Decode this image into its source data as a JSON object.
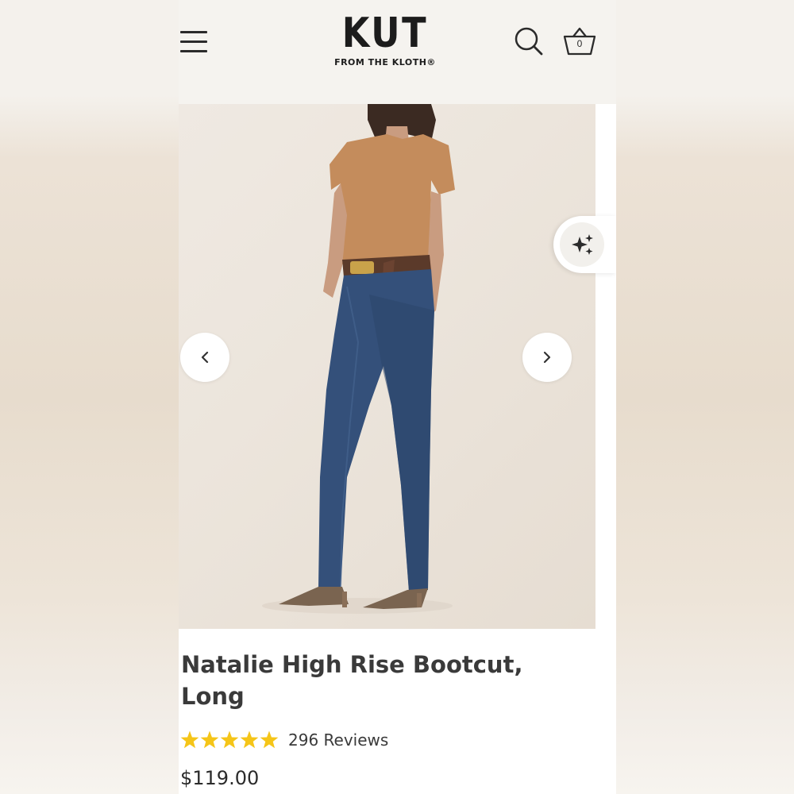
{
  "brand": {
    "name": "KUT",
    "tagline": "FROM THE KLOTH®"
  },
  "header": {
    "menu_icon": "hamburger-menu-icon",
    "search_icon": "search-icon",
    "cart_icon": "basket-icon",
    "cart_count": "0"
  },
  "gallery": {
    "image_alt": "Model wearing high rise bootcut jeans and tan t-shirt",
    "prev_icon": "chevron-left-icon",
    "next_icon": "chevron-right-icon",
    "ai_icon": "sparkles-icon"
  },
  "product": {
    "title": "Natalie High Rise Bootcut, Long",
    "rating": 5,
    "rating_max": 5,
    "reviews_label": "296 Reviews",
    "price": "$119.00"
  },
  "colors": {
    "star": "#f5c518",
    "text": "#3a3a3a",
    "header_bg": "#f5f3ef"
  }
}
